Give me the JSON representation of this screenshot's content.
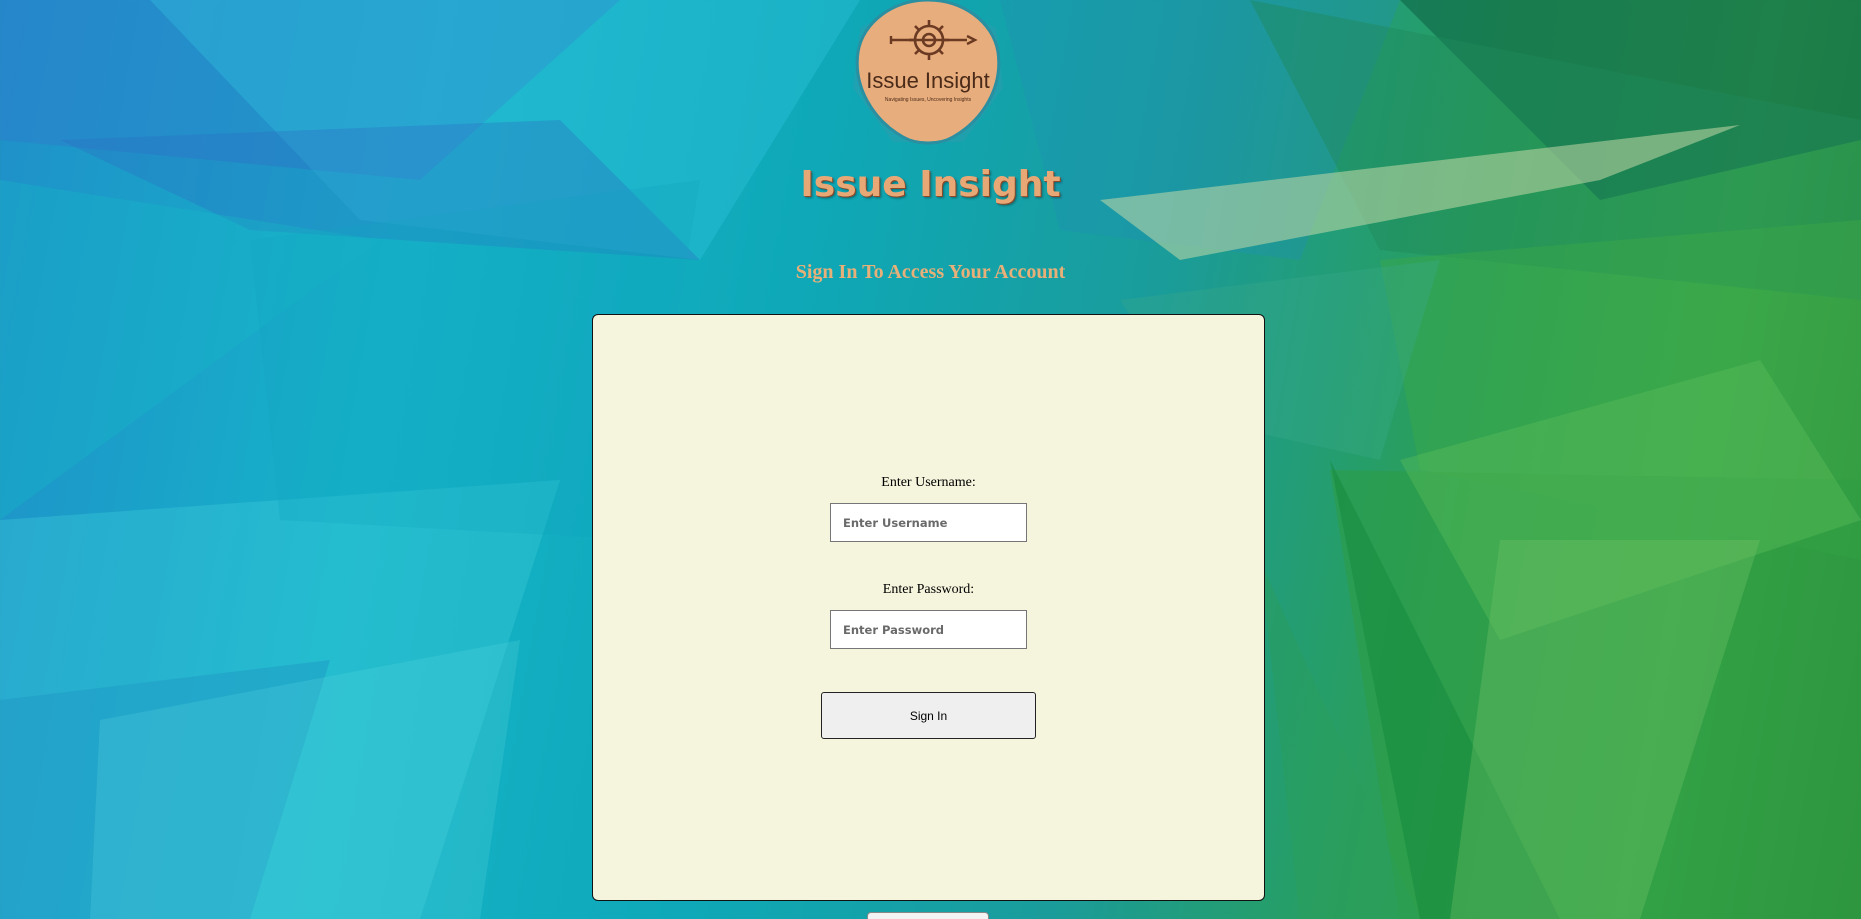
{
  "app": {
    "logo_text": "Issue Insight",
    "logo_tagline": "Navigating Issues, Uncovering Insights",
    "brand_title": "Issue Insight",
    "subtitle": "Sign In To Access Your Account"
  },
  "form": {
    "username_label": "Enter Username:",
    "username_placeholder": "Enter Username",
    "username_value": "",
    "password_label": "Enter Password:",
    "password_placeholder": "Enter Password",
    "password_value": "",
    "signin_label": "Sign In"
  },
  "colors": {
    "accent": "#e8a876",
    "card_bg": "#f5f4dc",
    "logo_fill": "#e8ad7d",
    "logo_dark": "#6b3a22"
  },
  "icons": {
    "logo": "gear-pencil-hexagon-icon"
  }
}
